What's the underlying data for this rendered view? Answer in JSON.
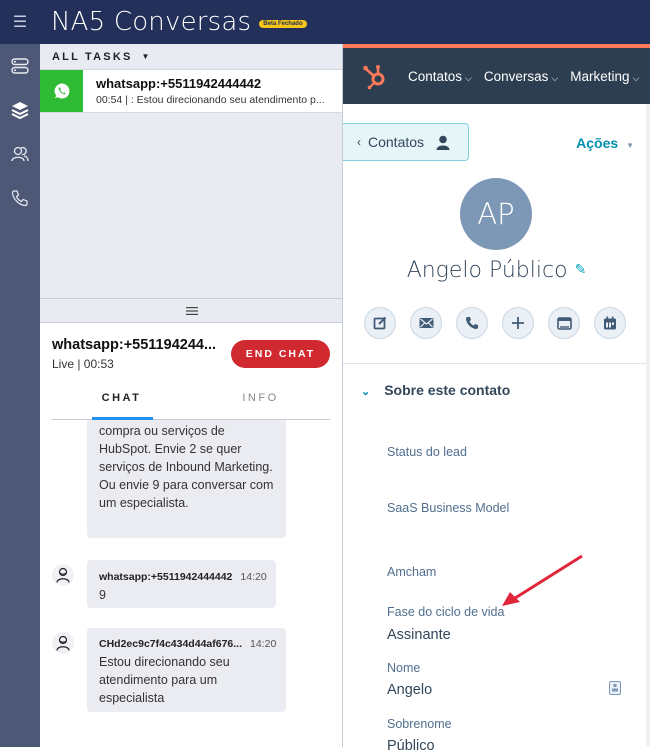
{
  "app": {
    "title": "NA5 Conversas",
    "badge": "Beta Fechado",
    "menu_icon": "hamburger-icon"
  },
  "rail": {
    "items": [
      {
        "icon": "tasks-icon"
      },
      {
        "icon": "layers-icon"
      },
      {
        "icon": "contacts-icon"
      },
      {
        "icon": "phone-icon"
      }
    ]
  },
  "tasks": {
    "header": "ALL TASKS",
    "items": [
      {
        "channel_icon": "whatsapp-icon",
        "title": "whatsapp:+5511942444442",
        "subtitle": "00:54 | : Estou direcionando seu atendimento p..."
      }
    ]
  },
  "chat": {
    "title": "whatsapp:+551194244...",
    "status": "Live | 00:53",
    "end_label": "END CHAT",
    "tabs": [
      {
        "label": "CHAT",
        "active": true
      },
      {
        "label": "INFO",
        "active": false
      }
    ],
    "messages": [
      {
        "author": "",
        "time": "",
        "text": "compra ou serviços de HubSpot. Envie 2 se quer serviços de Inbound Marketing. Ou envie 9 para conversar com um especialista."
      },
      {
        "author": "whatsapp:+5511942444442",
        "time": "14:20",
        "text": "9"
      },
      {
        "author": "CHd2ec9c7f4c434d44af676...",
        "time": "14:20",
        "text": "Estou direcionando seu atendimento para um especialista"
      }
    ]
  },
  "hubspot": {
    "nav": [
      {
        "label": "Contatos"
      },
      {
        "label": "Conversas"
      },
      {
        "label": "Marketing"
      }
    ],
    "back_label": "Contatos",
    "actions_label": "Ações",
    "contact": {
      "initials": "AP",
      "name": "Angelo Público",
      "action_buttons": [
        "note-icon",
        "email-icon",
        "call-icon",
        "add-icon",
        "task-icon",
        "meeting-icon"
      ]
    },
    "section_title": "Sobre este contato",
    "properties": [
      {
        "label": "Status do lead",
        "value": ""
      },
      {
        "label": "SaaS Business Model",
        "value": ""
      },
      {
        "label": "Amcham",
        "value": ""
      },
      {
        "label": "Fase do ciclo de vida",
        "value": "Assinante"
      },
      {
        "label": "Nome",
        "value": "Angelo"
      },
      {
        "label": "Sobrenome",
        "value": "Público"
      }
    ],
    "annotation_color": "#e0263a"
  }
}
